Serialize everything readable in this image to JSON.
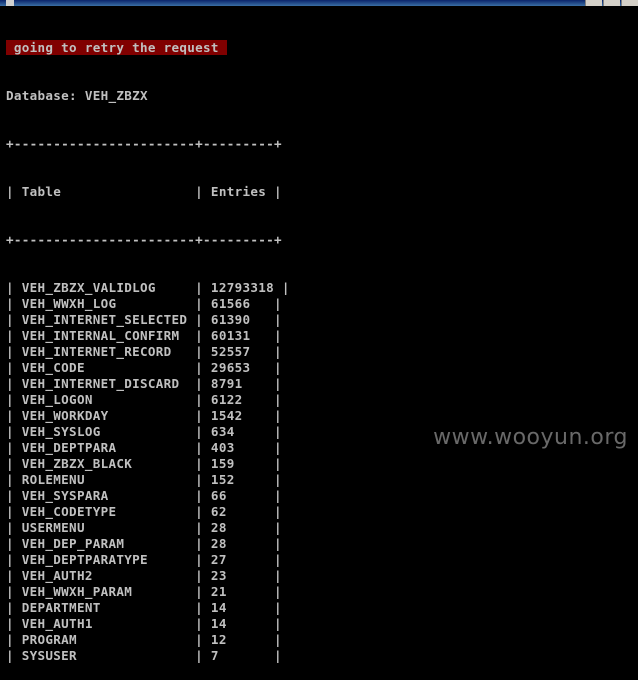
{
  "window": {
    "title": ""
  },
  "console": {
    "status_message": " going to retry the request ",
    "database_line": "Database: VEH_ZBZX",
    "border_line": "+-----------------------+---------+",
    "header_line": "| Table                 | Entries |",
    "rows": [
      {
        "table": "VEH_ZBZX_VALIDLOG",
        "entries": "12793318"
      },
      {
        "table": "VEH_WWXH_LOG",
        "entries": "61566"
      },
      {
        "table": "VEH_INTERNET_SELECTED",
        "entries": "61390"
      },
      {
        "table": "VEH_INTERNAL_CONFIRM",
        "entries": "60131"
      },
      {
        "table": "VEH_INTERNET_RECORD",
        "entries": "52557"
      },
      {
        "table": "VEH_CODE",
        "entries": "29653"
      },
      {
        "table": "VEH_INTERNET_DISCARD",
        "entries": "8791"
      },
      {
        "table": "VEH_LOGON",
        "entries": "6122"
      },
      {
        "table": "VEH_WORKDAY",
        "entries": "1542"
      },
      {
        "table": "VEH_SYSLOG",
        "entries": "634"
      },
      {
        "table": "VEH_DEPTPARA",
        "entries": "403"
      },
      {
        "table": "VEH_ZBZX_BLACK",
        "entries": "159"
      },
      {
        "table": "ROLEMENU",
        "entries": "152"
      },
      {
        "table": "VEH_SYSPARA",
        "entries": "66"
      },
      {
        "table": "VEH_CODETYPE",
        "entries": "62"
      },
      {
        "table": "USERMENU",
        "entries": "28"
      },
      {
        "table": "VEH_DEP_PARAM",
        "entries": "28"
      },
      {
        "table": "VEH_DEPTPARATYPE",
        "entries": "27"
      },
      {
        "table": "VEH_AUTH2",
        "entries": "23"
      },
      {
        "table": "VEH_WWXH_PARAM",
        "entries": "21"
      },
      {
        "table": "DEPARTMENT",
        "entries": "14"
      },
      {
        "table": "VEH_AUTH1",
        "entries": "14"
      },
      {
        "table": "PROGRAM",
        "entries": "12"
      },
      {
        "table": "SYSUSER",
        "entries": "7"
      }
    ]
  },
  "watermark": "www.wooyun.org",
  "colors": {
    "background": "#000000",
    "text": "#c0c0c0",
    "warning_background": "#800000"
  }
}
